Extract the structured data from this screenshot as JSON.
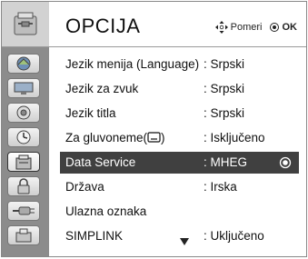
{
  "header": {
    "title": "OPCIJA",
    "move_hint": "Pomeri",
    "ok_hint": "OK"
  },
  "sidebar": {
    "items": [
      {
        "icon": "picture-icon"
      },
      {
        "icon": "screen-icon"
      },
      {
        "icon": "sound-icon"
      },
      {
        "icon": "time-icon"
      },
      {
        "icon": "option-icon",
        "active": true
      },
      {
        "icon": "lock-icon"
      },
      {
        "icon": "input-icon"
      },
      {
        "icon": "usb-icon"
      }
    ]
  },
  "menu": {
    "items": [
      {
        "label": "Jezik menija (Language)",
        "value": ": Srpski"
      },
      {
        "label": "Jezik za zvuk",
        "value": ": Srpski"
      },
      {
        "label": "Jezik titla",
        "value": ": Srpski"
      },
      {
        "label": "Za gluvoneme(",
        "label_suffix": ")",
        "value": ": Isključeno"
      },
      {
        "label": "Data Service",
        "value": ": MHEG",
        "selected": true
      },
      {
        "label": "Država",
        "value": ": Irska"
      },
      {
        "label": "Ulazna oznaka",
        "value": ""
      },
      {
        "label": "SIMPLINK",
        "value": ": Uključeno"
      }
    ]
  }
}
